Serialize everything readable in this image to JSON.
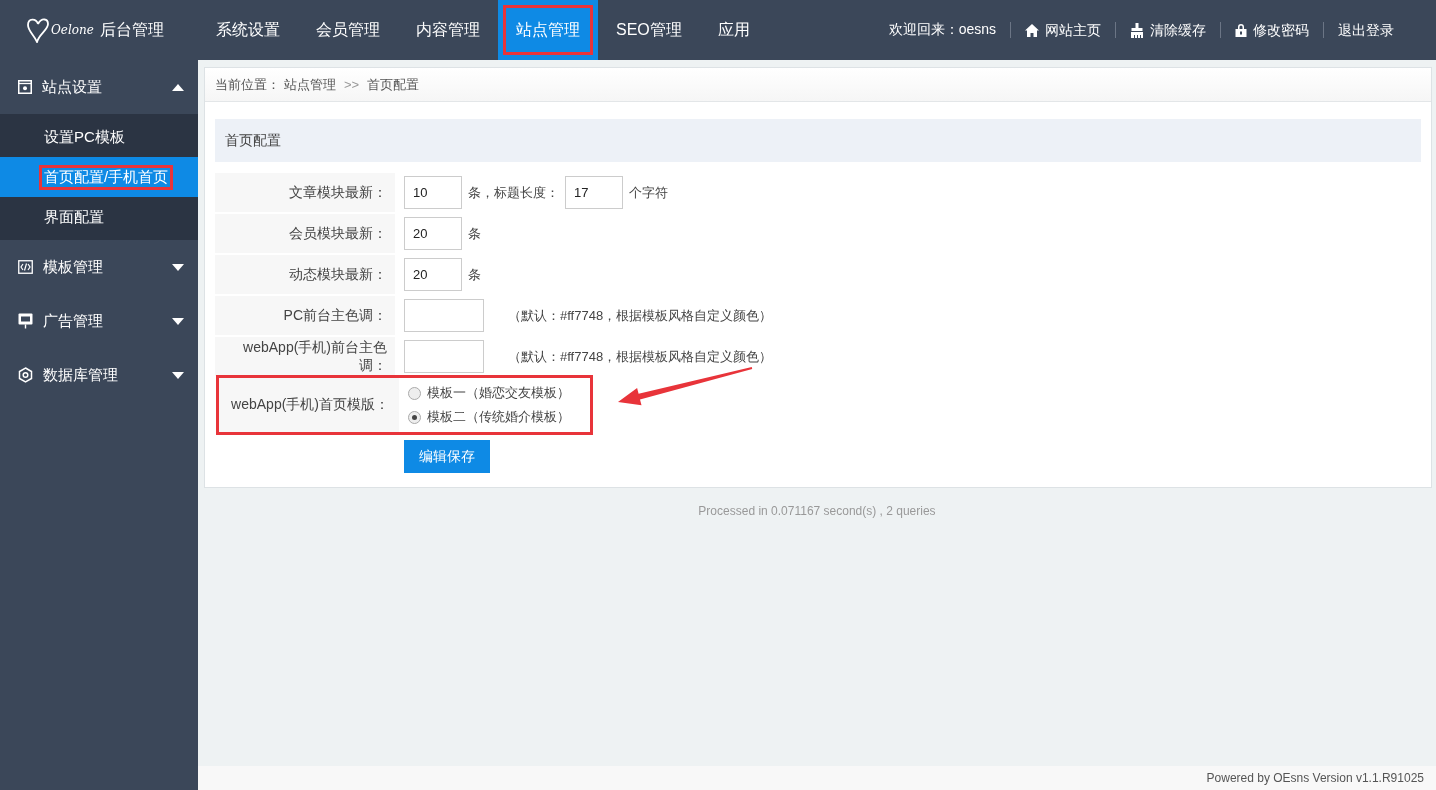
{
  "header": {
    "logo_text": "Oelone",
    "title": "后台管理",
    "nav": [
      {
        "label": "系统设置",
        "selected": false,
        "highlighted": false
      },
      {
        "label": "会员管理",
        "selected": false,
        "highlighted": false
      },
      {
        "label": "内容管理",
        "selected": false,
        "highlighted": false
      },
      {
        "label": "站点管理",
        "selected": true,
        "highlighted": true
      },
      {
        "label": "SEO管理",
        "selected": false,
        "highlighted": false
      },
      {
        "label": "应用",
        "selected": false,
        "highlighted": false
      }
    ],
    "welcome": "欢迎回来：oesns",
    "links": [
      {
        "kind": "home",
        "label": "网站主页"
      },
      {
        "kind": "broom",
        "label": "清除缓存"
      },
      {
        "kind": "lock",
        "label": "修改密码"
      },
      {
        "kind": "none",
        "label": "退出登录"
      }
    ]
  },
  "sidebar": {
    "groups": [
      {
        "kind": "site",
        "label": "站点设置",
        "expanded": true,
        "children": [
          {
            "label": "设置PC模板",
            "selected": false,
            "highlighted": false
          },
          {
            "label": "首页配置/手机首页",
            "selected": true,
            "highlighted": true
          },
          {
            "label": "界面配置",
            "selected": false,
            "highlighted": false
          }
        ]
      },
      {
        "kind": "code",
        "label": "模板管理",
        "expanded": false
      },
      {
        "kind": "ad",
        "label": "广告管理",
        "expanded": false
      },
      {
        "kind": "db",
        "label": "数据库管理",
        "expanded": false
      }
    ]
  },
  "breadcrumb": {
    "prefix": "当前位置：",
    "items": [
      "站点管理",
      "首页配置"
    ],
    "separator": ">>"
  },
  "section_title": "首页配置",
  "form": [
    {
      "kind": "inputs",
      "label": "文章模块最新：",
      "parts": [
        {
          "value": "10"
        },
        {
          "text": "条，标题长度："
        },
        {
          "value": "17"
        },
        {
          "text": "个字符"
        }
      ]
    },
    {
      "kind": "inputs",
      "label": "会员模块最新：",
      "parts": [
        {
          "value": "20"
        },
        {
          "text": "条"
        }
      ]
    },
    {
      "kind": "inputs",
      "label": "动态模块最新：",
      "parts": [
        {
          "value": "20"
        },
        {
          "text": "条"
        }
      ]
    },
    {
      "kind": "color",
      "label": "PC前台主色调：",
      "hint": "（默认：#ff7748，根据模板风格自定义颜色）"
    },
    {
      "kind": "color",
      "label": "webApp(手机)前台主色调：",
      "hint": "（默认：#ff7748，根据模板风格自定义颜色）"
    },
    {
      "kind": "radio",
      "label": "webApp(手机)首页模版：",
      "highlighted": true,
      "options": [
        {
          "label": "模板一（婚恋交友模板）",
          "selected": false
        },
        {
          "label": "模板二（传统婚介模板）",
          "selected": true
        }
      ]
    }
  ],
  "save_button": "编辑保存",
  "stats": "Processed in 0.071167 second(s) , 2 queries",
  "footer": "Powered by OEsns Version v1.1.R91025",
  "annotation_arrow": true
}
